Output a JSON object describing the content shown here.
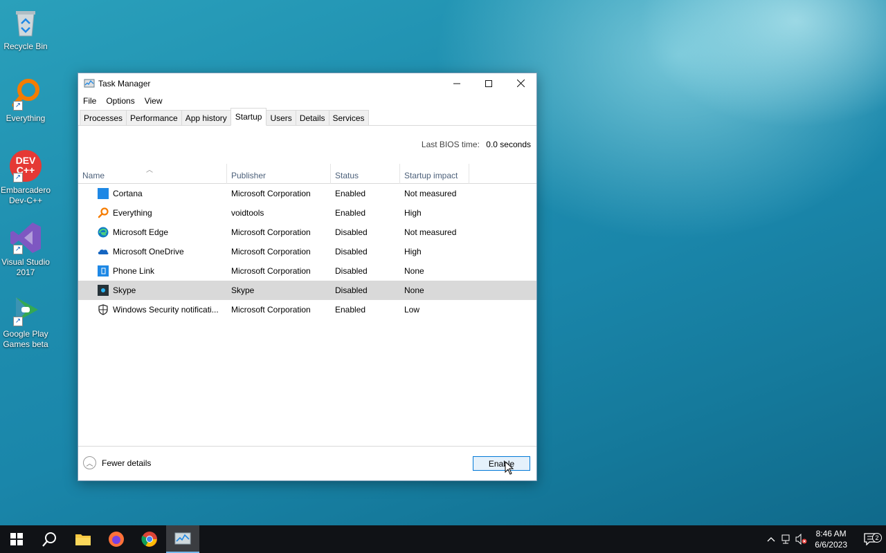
{
  "desktop": {
    "icons": [
      {
        "label": "Recycle Bin"
      },
      {
        "label": "Everything"
      },
      {
        "label": "Embarcadero Dev-C++"
      },
      {
        "label": "Visual Studio 2017"
      },
      {
        "label": "Google Play Games beta"
      }
    ],
    "devcpp_logo_text": "DEV C++"
  },
  "window": {
    "title": "Task Manager",
    "menu": [
      "File",
      "Options",
      "View"
    ],
    "tabs": [
      "Processes",
      "Performance",
      "App history",
      "Startup",
      "Users",
      "Details",
      "Services"
    ],
    "active_tab": "Startup",
    "bios_label": "Last BIOS time:",
    "bios_value": "0.0 seconds",
    "columns": [
      "Name",
      "Publisher",
      "Status",
      "Startup impact"
    ],
    "rows": [
      {
        "name": "Cortana",
        "publisher": "Microsoft Corporation",
        "status": "Enabled",
        "impact": "Not measured",
        "icon": "cortana-icon"
      },
      {
        "name": "Everything",
        "publisher": "voidtools",
        "status": "Enabled",
        "impact": "High",
        "icon": "everything-icon"
      },
      {
        "name": "Microsoft Edge",
        "publisher": "Microsoft Corporation",
        "status": "Disabled",
        "impact": "Not measured",
        "icon": "edge-icon"
      },
      {
        "name": "Microsoft OneDrive",
        "publisher": "Microsoft Corporation",
        "status": "Disabled",
        "impact": "High",
        "icon": "onedrive-icon"
      },
      {
        "name": "Phone Link",
        "publisher": "Microsoft Corporation",
        "status": "Disabled",
        "impact": "None",
        "icon": "phone-link-icon"
      },
      {
        "name": "Skype",
        "publisher": "Skype",
        "status": "Disabled",
        "impact": "None",
        "icon": "skype-icon",
        "selected": true
      },
      {
        "name": "Windows Security notificati...",
        "publisher": "Microsoft Corporation",
        "status": "Enabled",
        "impact": "Low",
        "icon": "shield-icon"
      }
    ],
    "fewer_details": "Fewer details",
    "enable_button": "Enable"
  },
  "taskbar": {
    "time": "8:46 AM",
    "date": "6/6/2023",
    "notification_count": "2"
  },
  "colors": {
    "accent": "#0078d7",
    "selected_row": "#d9d9d9",
    "taskbar": "#101216"
  }
}
